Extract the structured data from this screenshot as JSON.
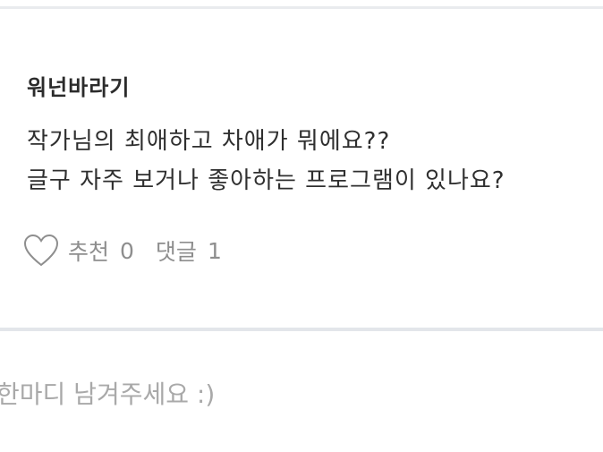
{
  "comment": {
    "author": "워넌바라기",
    "lines": [
      "작가님의 최애하고 차애가 뭐에요??",
      "글구 자주 보거나 좋아하는 프로그램이 있나요?"
    ],
    "like_label": "추천",
    "like_count": "0",
    "reply_label": "댓글",
    "reply_count": "1"
  },
  "reply_input": {
    "placeholder": "한마디 남겨주세요 :)"
  },
  "icons": {
    "like": "heart-outline-icon"
  },
  "colors": {
    "divider": "#e3e6ea",
    "meta_text": "#8e8e8e",
    "placeholder": "#a9a9a9"
  }
}
